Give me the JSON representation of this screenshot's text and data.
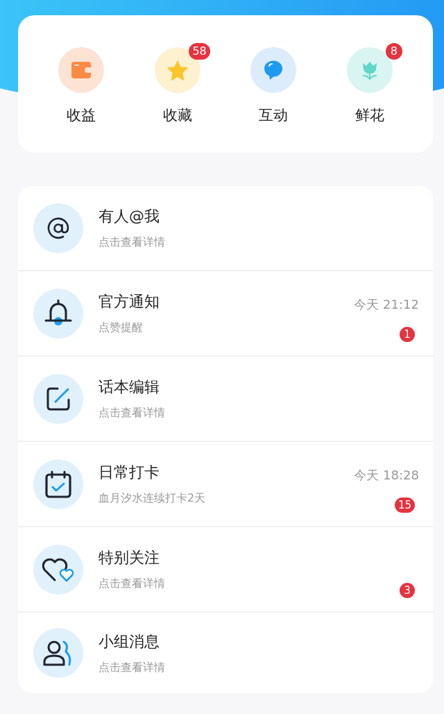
{
  "shortcuts": [
    {
      "kind": "wallet",
      "label": "收益"
    },
    {
      "kind": "star",
      "label": "收藏",
      "badge": "58"
    },
    {
      "kind": "chat",
      "label": "互动"
    },
    {
      "kind": "flower",
      "label": "鲜花",
      "badge": "8"
    }
  ],
  "messages": [
    {
      "kind": "at",
      "title": "有人@我",
      "subtitle": "点击查看详情"
    },
    {
      "kind": "bell",
      "title": "官方通知",
      "subtitle": "点赞提醒",
      "time": "今天 21:12",
      "badge": "1"
    },
    {
      "kind": "edit",
      "title": "话本编辑",
      "subtitle": "点击查看详情"
    },
    {
      "kind": "calendar",
      "title": "日常打卡",
      "subtitle": "血月汐水连续打卡2天",
      "time": "今天 18:28",
      "badge": "15"
    },
    {
      "kind": "hearts",
      "title": "特别关注",
      "subtitle": "点击查看详情",
      "badge": "3"
    },
    {
      "kind": "group",
      "title": "小组消息",
      "subtitle": "点击查看详情"
    }
  ]
}
